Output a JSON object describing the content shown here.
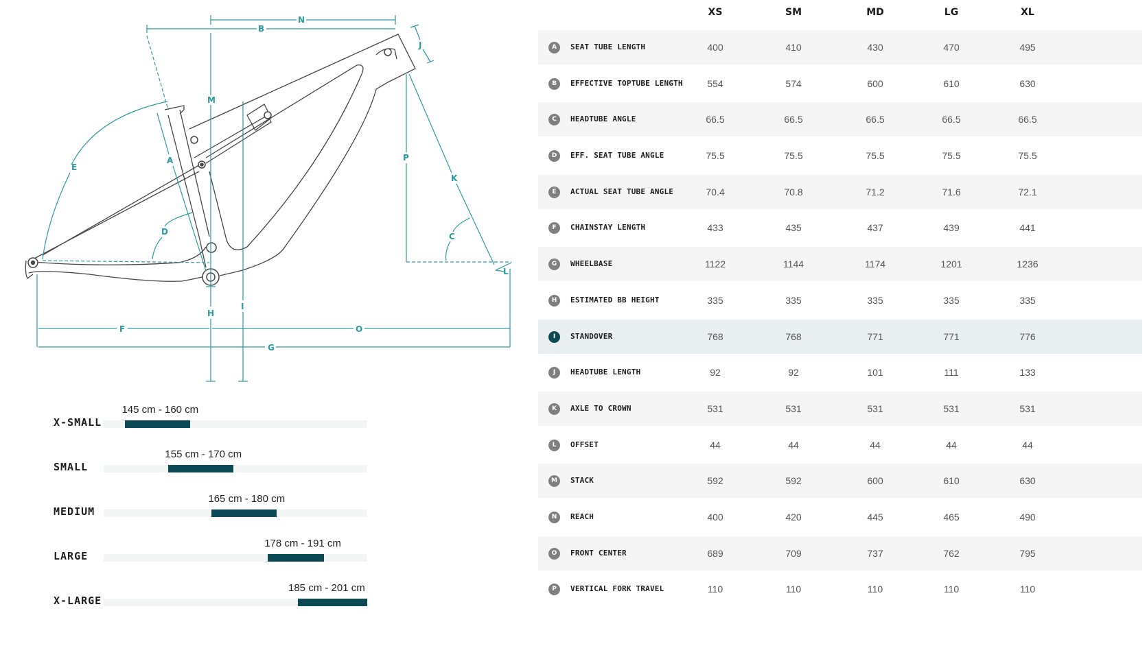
{
  "diagram": {
    "labels": {
      "A": "A",
      "B": "B",
      "C": "C",
      "D": "D",
      "E": "E",
      "F": "F",
      "G": "G",
      "H": "H",
      "I": "I",
      "J": "J",
      "K": "K",
      "L": "L",
      "M": "M",
      "N": "N",
      "O": "O",
      "P": "P"
    },
    "colors": {
      "dimension": "#2a9aa1",
      "frame": "#444444"
    }
  },
  "rider_sizes": [
    {
      "label": "X-SMALL",
      "range": "145 cm - 160 cm",
      "min_cm": 145,
      "max_cm": 160
    },
    {
      "label": "SMALL",
      "range": "155 cm - 170 cm",
      "min_cm": 155,
      "max_cm": 170
    },
    {
      "label": "MEDIUM",
      "range": "165 cm - 180 cm",
      "min_cm": 165,
      "max_cm": 180
    },
    {
      "label": "LARGE",
      "range": "178 cm - 191 cm",
      "min_cm": 178,
      "max_cm": 191
    },
    {
      "label": "X-LARGE",
      "range": "185 cm - 201 cm",
      "min_cm": 185,
      "max_cm": 201
    }
  ],
  "geometry": {
    "columns": [
      "XS",
      "SM",
      "MD",
      "LG",
      "XL"
    ],
    "rows": [
      {
        "letter": "A",
        "name": "SEAT TUBE LENGTH",
        "values": [
          "400",
          "410",
          "430",
          "470",
          "495"
        ]
      },
      {
        "letter": "B",
        "name": "EFFECTIVE TOPTUBE LENGTH",
        "values": [
          "554",
          "574",
          "600",
          "610",
          "630"
        ]
      },
      {
        "letter": "C",
        "name": "HEADTUBE ANGLE",
        "values": [
          "66.5",
          "66.5",
          "66.5",
          "66.5",
          "66.5"
        ]
      },
      {
        "letter": "D",
        "name": "EFF. SEAT TUBE ANGLE",
        "values": [
          "75.5",
          "75.5",
          "75.5",
          "75.5",
          "75.5"
        ]
      },
      {
        "letter": "E",
        "name": "ACTUAL SEAT TUBE ANGLE",
        "values": [
          "70.4",
          "70.8",
          "71.2",
          "71.6",
          "72.1"
        ]
      },
      {
        "letter": "F",
        "name": "CHAINSTAY LENGTH",
        "values": [
          "433",
          "435",
          "437",
          "439",
          "441"
        ]
      },
      {
        "letter": "G",
        "name": "WHEELBASE",
        "values": [
          "1122",
          "1144",
          "1174",
          "1201",
          "1236"
        ]
      },
      {
        "letter": "H",
        "name": "ESTIMATED BB HEIGHT",
        "values": [
          "335",
          "335",
          "335",
          "335",
          "335"
        ]
      },
      {
        "letter": "I",
        "name": "STANDOVER",
        "values": [
          "768",
          "768",
          "771",
          "771",
          "776"
        ],
        "active": true
      },
      {
        "letter": "J",
        "name": "HEADTUBE LENGTH",
        "values": [
          "92",
          "92",
          "101",
          "111",
          "133"
        ]
      },
      {
        "letter": "K",
        "name": "AXLE TO CROWN",
        "values": [
          "531",
          "531",
          "531",
          "531",
          "531"
        ]
      },
      {
        "letter": "L",
        "name": "OFFSET",
        "values": [
          "44",
          "44",
          "44",
          "44",
          "44"
        ]
      },
      {
        "letter": "M",
        "name": "STACK",
        "values": [
          "592",
          "592",
          "600",
          "610",
          "630"
        ]
      },
      {
        "letter": "N",
        "name": "REACH",
        "values": [
          "400",
          "420",
          "445",
          "465",
          "490"
        ]
      },
      {
        "letter": "O",
        "name": "FRONT CENTER",
        "values": [
          "689",
          "709",
          "737",
          "762",
          "795"
        ]
      },
      {
        "letter": "P",
        "name": "VERTICAL FORK TRAVEL",
        "values": [
          "110",
          "110",
          "110",
          "110",
          "110"
        ]
      }
    ]
  }
}
